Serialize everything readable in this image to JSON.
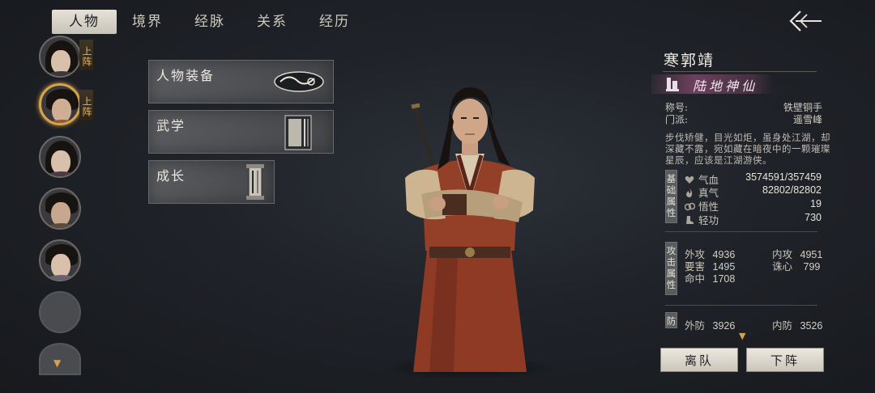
{
  "tabs": [
    {
      "label": "人物",
      "active": true
    },
    {
      "label": "境界",
      "active": false
    },
    {
      "label": "经脉",
      "active": false
    },
    {
      "label": "关系",
      "active": false
    },
    {
      "label": "经历",
      "active": false
    }
  ],
  "back_icon": "back-arrow-icon",
  "party": {
    "tag_label": "上阵",
    "scroll_icon": "chevron-down-icon"
  },
  "menu": {
    "equipment": "人物装备",
    "martial": "武学",
    "growth": "成长"
  },
  "character": {
    "name": "寒郭靖",
    "realm": "陆地神仙",
    "title_label": "称号:",
    "title_value": "铁壁铜手",
    "sect_label": "门派:",
    "sect_value": "遥雪峰",
    "description": "步伐矫健，目光如炬，虽身处江湖，却深藏不露，宛如藏在暗夜中的一颗璀璨星辰，应该是江湖游侠。"
  },
  "basic": {
    "tag": "基础属性",
    "hp_label": "气血",
    "hp_value": "3574591/357459",
    "qi_label": "真气",
    "qi_value": "82802/82802",
    "wu_label": "悟性",
    "wu_value": "19",
    "qg_label": "轻功",
    "qg_value": "730"
  },
  "attack": {
    "tag": "攻击属性",
    "outer_label": "外攻",
    "outer_value": "4936",
    "inner_label": "内攻",
    "inner_value": "4951",
    "vital_label": "要害",
    "vital_value": "1495",
    "heart_label": "诛心",
    "heart_value": "799",
    "hit_label": "命中",
    "hit_value": "1708"
  },
  "defense": {
    "tag": "防",
    "outer_label": "外防",
    "outer_value": "3926",
    "inner_label": "内防",
    "inner_value": "3526"
  },
  "actions": {
    "leave": "离队",
    "unassign": "下阵"
  },
  "colors": {
    "accent_gold": "#d6a24a",
    "realm_banner": "#965078"
  }
}
